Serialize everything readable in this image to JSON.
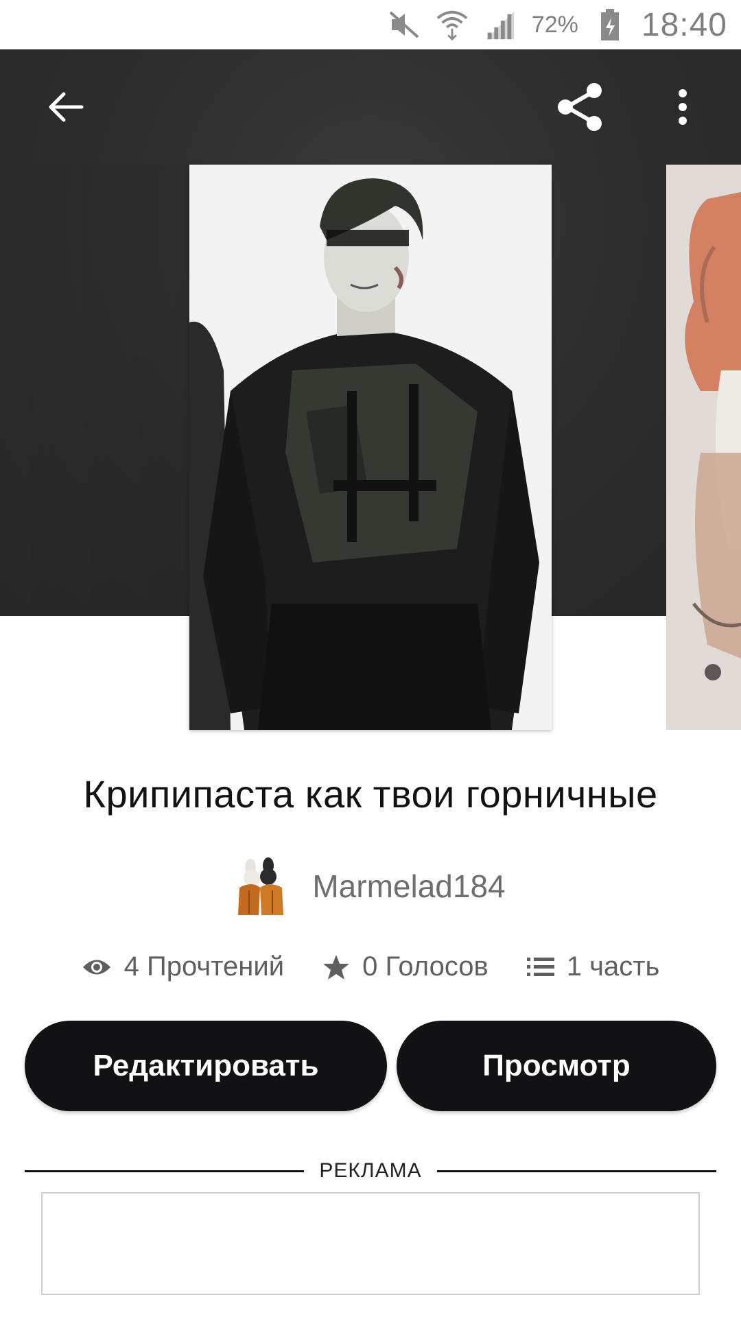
{
  "status_bar": {
    "battery_percent": "72%",
    "time": "18:40",
    "icons": [
      "mute-icon",
      "wifi-icon",
      "signal-icon",
      "battery-charging-icon"
    ]
  },
  "toolbar": {
    "icons": [
      "back-arrow-icon",
      "share-icon",
      "more-vertical-icon"
    ]
  },
  "story": {
    "title": "Крипипаста как твои горничные",
    "author": "Marmelad184",
    "stats": {
      "reads": "4 Прочтений",
      "votes": "0 Голосов",
      "parts": "1 часть"
    }
  },
  "actions": {
    "edit_label": "Редактировать",
    "view_label": "Просмотр"
  },
  "ad": {
    "label": "РЕКЛАМА"
  },
  "colors": {
    "hero_bg": "#2c2c2c",
    "button_bg": "#121113",
    "button_text": "#ffffff",
    "muted_text": "#6e6e6e"
  }
}
